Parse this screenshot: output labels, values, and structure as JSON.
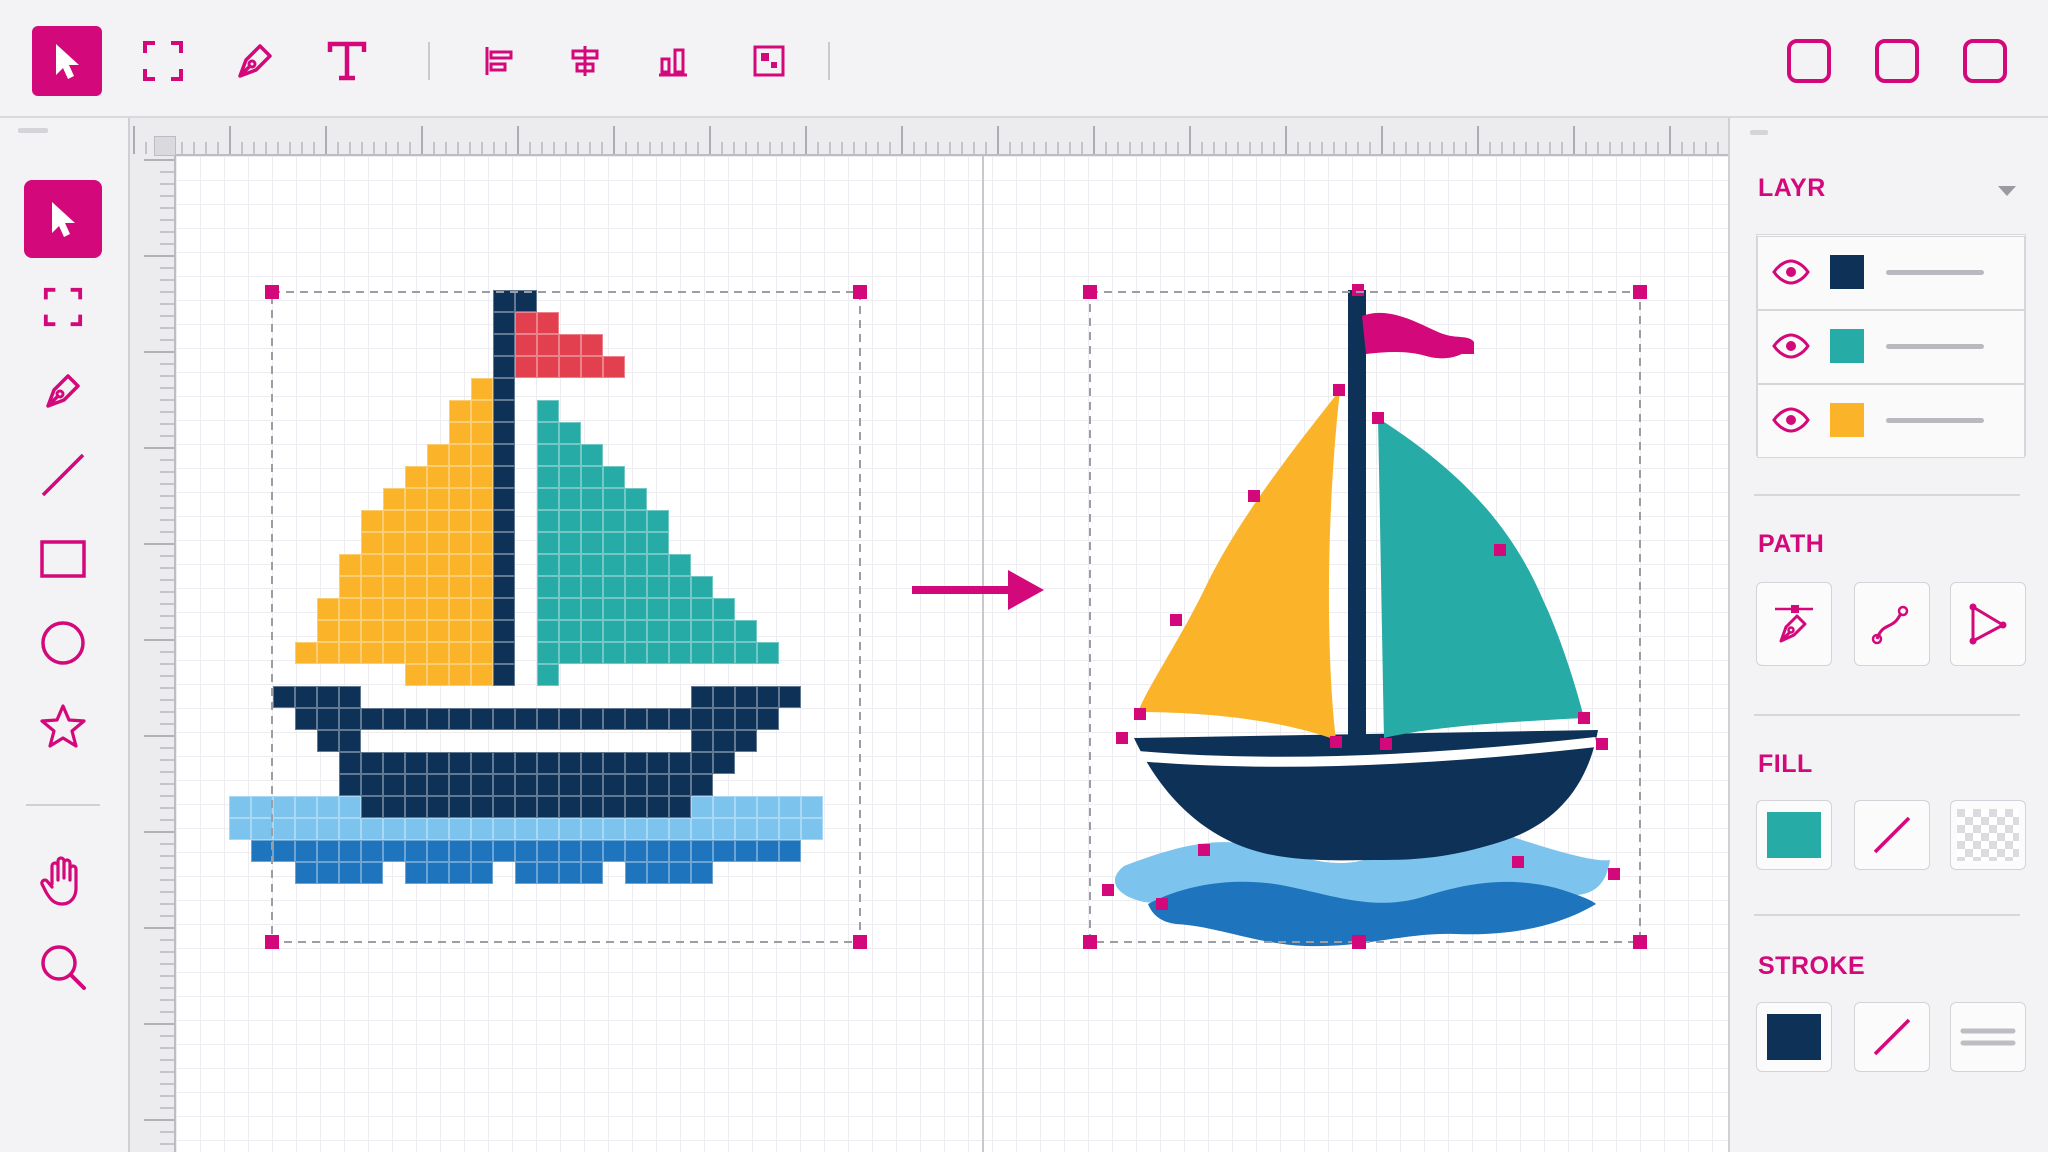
{
  "colors": {
    "accent": "#d3087a",
    "navy": "#0e3257",
    "teal": "#26aba6",
    "yellow": "#fbb42a",
    "red": "#e2404e",
    "water_light": "#7cc4ee",
    "water_dark": "#1e74bd"
  },
  "top_toolbar": {
    "tools": [
      {
        "icon": "select-arrow-icon",
        "active": true
      },
      {
        "icon": "marquee-icon",
        "active": false
      },
      {
        "icon": "pen-icon",
        "active": false
      },
      {
        "icon": "text-tool-icon",
        "active": false
      }
    ],
    "align_tools": [
      "align-left-icon",
      "align-center-icon",
      "align-bottom-icon",
      "distribute-icon"
    ],
    "window_buttons": [
      "window-button-1",
      "window-button-2",
      "window-button-3"
    ]
  },
  "left_toolbar": {
    "tools": [
      "select-arrow-icon",
      "marquee-icon",
      "pen-icon",
      "line-icon",
      "rectangle-icon",
      "ellipse-icon",
      "star-icon",
      "hand-icon",
      "zoom-icon"
    ],
    "active_tool": "select-arrow-icon"
  },
  "panel": {
    "layers": {
      "title": "LAYR",
      "items": [
        {
          "swatch": "#0e3257",
          "visible": true
        },
        {
          "swatch": "#26aba6",
          "visible": true
        },
        {
          "swatch": "#fbb42a",
          "visible": true
        }
      ]
    },
    "path": {
      "title": "PATH",
      "tools": [
        "pen-anchor-icon",
        "curve-path-icon",
        "node-select-icon"
      ]
    },
    "fill": {
      "title": "FILL",
      "swatch": "#26aba6",
      "options": [
        "fill-color-swatch",
        "no-fill-icon",
        "transparent-fill-icon"
      ]
    },
    "stroke": {
      "title": "STROKE",
      "swatch": "#0e3257",
      "options": [
        "stroke-color-swatch",
        "no-stroke-icon",
        "stroke-lines-icon"
      ]
    }
  }
}
